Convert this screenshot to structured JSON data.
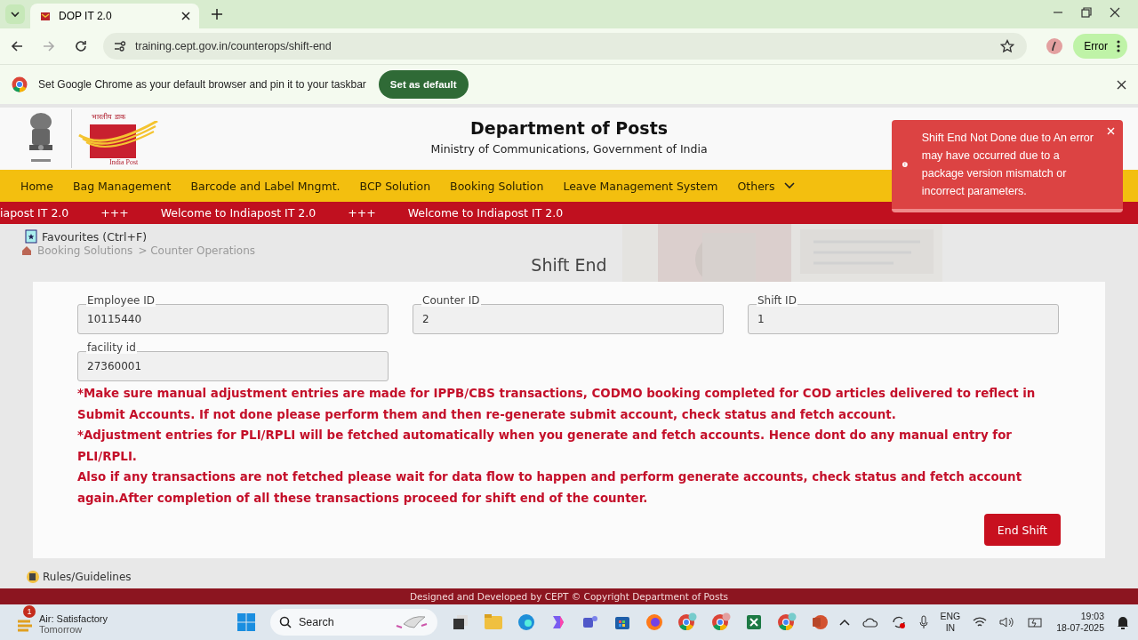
{
  "browser": {
    "tabs": [
      {
        "title": "DOP IT 2.0",
        "selected": true
      }
    ],
    "url": "training.cept.gov.in/counterops/shift-end",
    "profile_status": "Error"
  },
  "infobar": {
    "message": "Set Google Chrome as your default browser and pin it to your taskbar",
    "button": "Set as default"
  },
  "header": {
    "logo_hindi": "भारतीय डाक",
    "logo_text": "India Post",
    "title": "Department of Posts",
    "subtitle": "Ministry of Communications, Government of India"
  },
  "nav": [
    "Home",
    "Bag Management",
    "Barcode and Label Mngmt.",
    "BCP Solution",
    "Booking Solution",
    "Leave Management System",
    "Others"
  ],
  "marquee": [
    "iapost IT 2.0",
    "+++",
    "Welcome to Indiapost IT 2.0",
    "+++",
    "Welcome to Indiapost IT 2.0"
  ],
  "favourites": "Favourites (Ctrl+F)",
  "breadcrumb": [
    "Booking Solutions",
    "> Counter Operations"
  ],
  "page_title": "Shift End",
  "fields": [
    {
      "label": "Employee ID",
      "value": "10115440"
    },
    {
      "label": "Counter ID",
      "value": "2"
    },
    {
      "label": "Shift ID",
      "value": "1"
    },
    {
      "label": "facility id",
      "value": "27360001"
    }
  ],
  "notes": [
    "*Make sure manual adjustment entries are made for IPPB/CBS transactions, CODMO booking completed for COD articles delivered to reflect in Submit Accounts. If not done please perform them and then re-generate submit account, check status and fetch account.",
    "*Adjustment entries for PLI/RPLI will be fetched automatically when you generate and fetch accounts. Hence dont do any manual entry for PLI/RPLI.",
    "Also if any transactions are not fetched please wait for data flow to happen and perform generate accounts, check status and fetch account again.After completion of all these transactions proceed for shift end of the counter."
  ],
  "end_button": "End Shift",
  "rules": "Rules/Guidelines",
  "footer": "Designed and Developed by CEPT © Copyright Department of Posts",
  "toast": {
    "message": "Shift End Not Done due to An error may have occurred due to a package version mismatch or incorrect parameters."
  },
  "taskbar": {
    "weather_badge": "1",
    "weather_title": "Air: Satisfactory",
    "weather_sub": "Tomorrow",
    "search": "Search",
    "lang": "ENG",
    "region": "IN",
    "time": "19:03",
    "date": "18-07-2025"
  }
}
